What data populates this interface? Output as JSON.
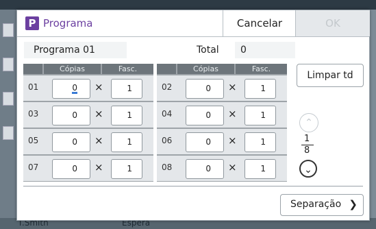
{
  "background": {
    "bottom_left_text": "T.Smith",
    "bottom_mid_text": "Espera"
  },
  "dialog": {
    "icon_letter": "P",
    "title": "Programa",
    "cancel_label": "Cancelar",
    "ok_label": "OK"
  },
  "program": {
    "name": "Programa 01",
    "total_label": "Total",
    "total_value": "0"
  },
  "grid_headers": {
    "copies": "Cópias",
    "sets": "Fasc."
  },
  "times_symbol": "×",
  "rows": [
    {
      "num": "01",
      "copies": "0",
      "sets": "1"
    },
    {
      "num": "02",
      "copies": "0",
      "sets": "1"
    },
    {
      "num": "03",
      "copies": "0",
      "sets": "1"
    },
    {
      "num": "04",
      "copies": "0",
      "sets": "1"
    },
    {
      "num": "05",
      "copies": "0",
      "sets": "1"
    },
    {
      "num": "06",
      "copies": "0",
      "sets": "1"
    },
    {
      "num": "07",
      "copies": "0",
      "sets": "1"
    },
    {
      "num": "08",
      "copies": "0",
      "sets": "1"
    }
  ],
  "clear_label": "Limpar td",
  "pager": {
    "current": "1",
    "total": "8",
    "up_icon": "chevron-up-icon",
    "down_icon": "chevron-down-icon"
  },
  "separation_label": "Separação",
  "colors": {
    "accent": "#6b3fa0",
    "cursor": "#3a7bd5"
  }
}
